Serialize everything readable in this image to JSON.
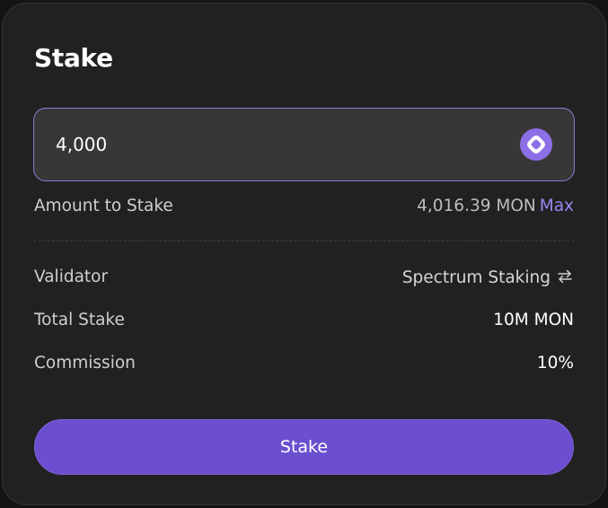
{
  "card": {
    "title": "Stake"
  },
  "amount": {
    "value": "4,000",
    "token_icon": "mon-token-icon",
    "label": "Amount to Stake",
    "balance": "4,016.39 MON",
    "max_label": "Max"
  },
  "details": {
    "validator_label": "Validator",
    "validator_value": "Spectrum Staking",
    "validator_switch_icon": "swap-arrows-icon",
    "total_stake_label": "Total Stake",
    "total_stake_value": "10M MON",
    "commission_label": "Commission",
    "commission_value": "10%"
  },
  "actions": {
    "stake_label": "Stake"
  },
  "colors": {
    "background": "#222121",
    "accent": "#6c4fcf",
    "accent_light": "#9a86f0",
    "input_border": "#8f7ad8"
  }
}
